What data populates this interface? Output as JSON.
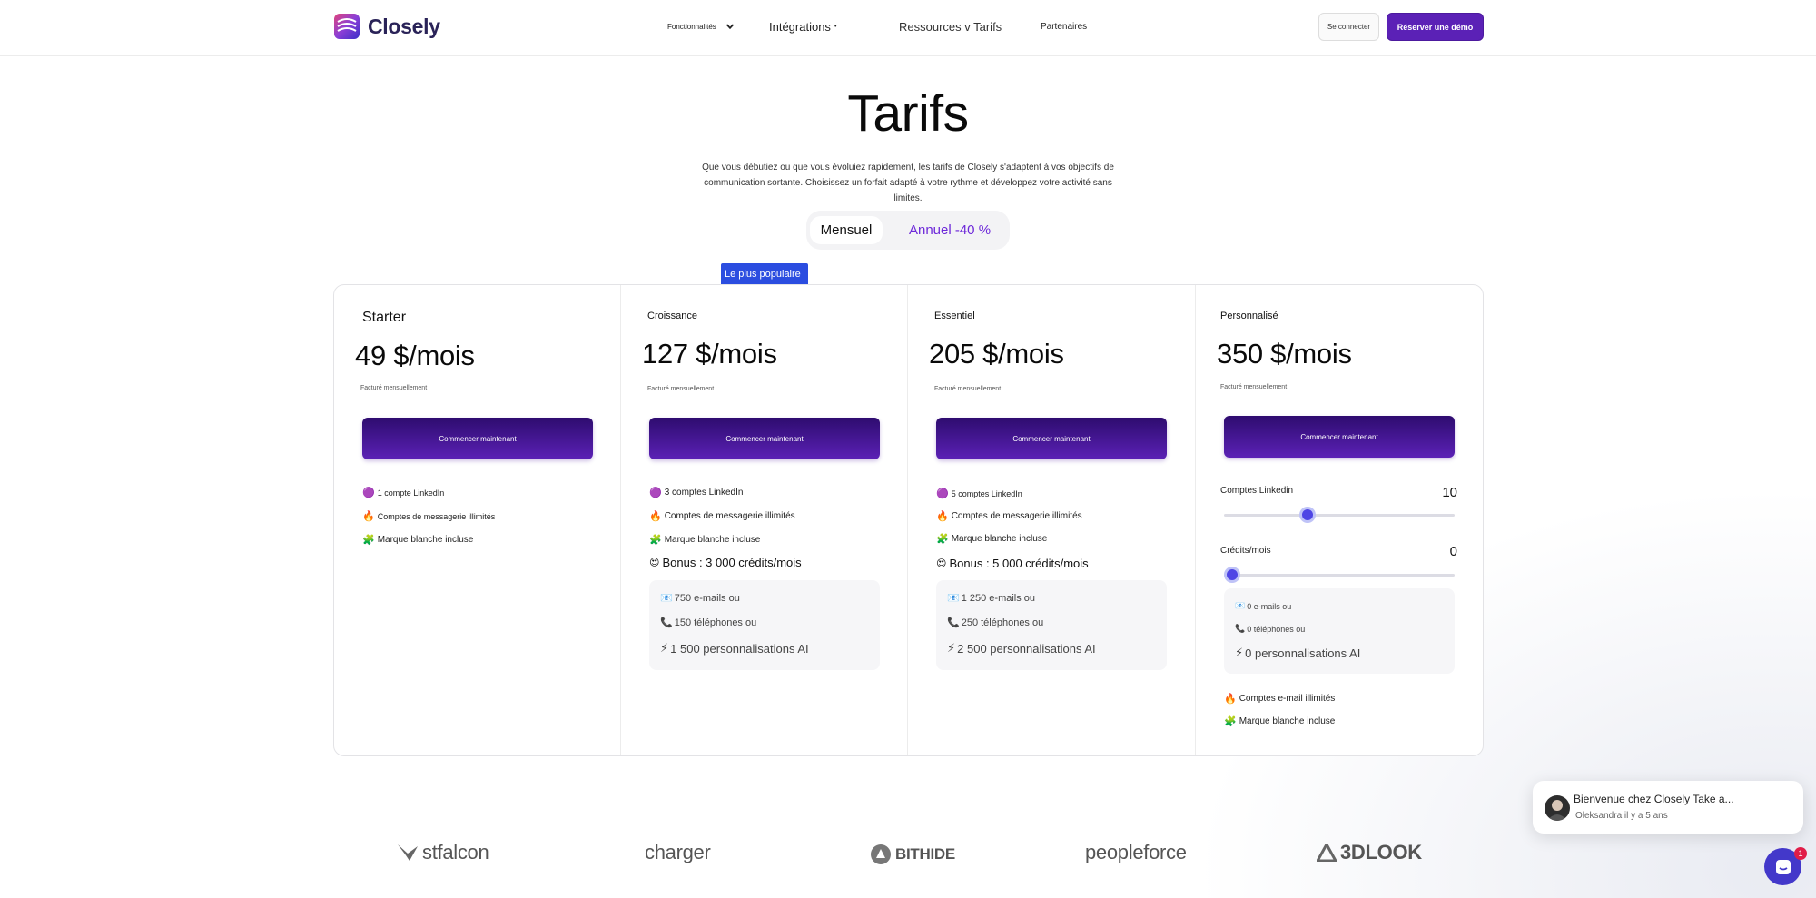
{
  "nav": {
    "brand": "Closely",
    "features_label": "Fonctionnalités",
    "integrations_label": "Intégrations",
    "integrations_marker": "•",
    "resources_label": "Ressources v Tarifs",
    "partners_label": "Partenaires",
    "login_label": "Se connecter",
    "demo_label": "Réserver une démo"
  },
  "hero": {
    "title": "Tarifs",
    "subtitle": "Que vous débutiez ou que vous évoluiez rapidement, les tarifs de Closely s'adaptent à vos objectifs de communication sortante. Choisissez un forfait adapté à votre rythme et développez votre activité sans limites.",
    "toggle_monthly": "Mensuel",
    "toggle_annual": "Annuel -40 %",
    "popular_badge": "Le plus populaire",
    "popular_badge_icon": "L"
  },
  "plans": [
    {
      "name": "Starter",
      "price": "49 $/mois",
      "billing": "Facturé mensuellement",
      "cta": "Commencer maintenant",
      "features": [
        {
          "icon": "🟣",
          "text": "1 compte LinkedIn"
        },
        {
          "icon": "🔥",
          "text": "Comptes de messagerie illimités"
        },
        {
          "icon": "🧩",
          "text": "Marque blanche incluse"
        }
      ]
    },
    {
      "name": "Croissance",
      "price": "127 $/mois",
      "billing": "Facturé mensuellement",
      "cta": "Commencer maintenant",
      "features": [
        {
          "icon": "🟣",
          "text": "3 comptes LinkedIn"
        },
        {
          "icon": "🔥",
          "text": "Comptes de messagerie illimités"
        },
        {
          "icon": "🧩",
          "text": "Marque blanche incluse"
        }
      ],
      "bonus": {
        "icon": "😍",
        "text": "Bonus : 3 000 crédits/mois"
      },
      "credits": [
        {
          "icon": "📧",
          "text": "750 e-mails ou"
        },
        {
          "icon": "📞",
          "text": "150 téléphones ou"
        },
        {
          "icon": "⚡",
          "text": "1 500 personnalisations AI"
        }
      ]
    },
    {
      "name": "Essentiel",
      "price": "205 $/mois",
      "billing": "Facturé mensuellement",
      "cta": "Commencer maintenant",
      "features": [
        {
          "icon": "🟣",
          "text": "5 comptes LinkedIn"
        },
        {
          "icon": "🔥",
          "text": "Comptes de messagerie illimités"
        },
        {
          "icon": "🧩",
          "text": "Marque blanche incluse"
        }
      ],
      "bonus": {
        "icon": "😍",
        "text": "Bonus : 5 000 crédits/mois"
      },
      "credits": [
        {
          "icon": "📧",
          "text": "1 250 e-mails ou"
        },
        {
          "icon": "📞",
          "text": "250 téléphones ou"
        },
        {
          "icon": "⚡",
          "text": "2 500 personnalisations AI"
        }
      ]
    },
    {
      "name": "Personnalisé",
      "price": "350 $/mois",
      "billing": "Facturé mensuellement",
      "cta": "Commencer maintenant",
      "slider_accounts": {
        "label": "Comptes Linkedin",
        "value": "10",
        "fraction": 0.35
      },
      "slider_credits": {
        "label": "Crédits/mois",
        "value": "0",
        "fraction": 0.0
      },
      "credits": [
        {
          "icon": "📧",
          "text": "0 e-mails ou"
        },
        {
          "icon": "📞",
          "text": "0 téléphones ou"
        },
        {
          "icon": "⚡",
          "text": "0 personnalisations AI"
        }
      ],
      "extras": [
        {
          "icon": "🔥",
          "text": "Comptes e-mail illimités"
        },
        {
          "icon": "🧩",
          "text": "Marque blanche incluse"
        }
      ]
    }
  ],
  "logos": [
    "stfalcon",
    "charger",
    "BITHIDE",
    "peopleforce",
    "3DLOOK"
  ],
  "chat": {
    "message": "Bienvenue chez Closely Take a...",
    "meta": "Oleksandra il y a 5 ans",
    "unread": "1"
  },
  "colors": {
    "brand_purple": "#5b21b6",
    "annual_purple": "#6d28d9",
    "badge_blue": "#2b4de0",
    "slider_thumb": "#4f46e5",
    "chat_launcher": "#4338ca",
    "unread_badge": "#e11d48"
  }
}
